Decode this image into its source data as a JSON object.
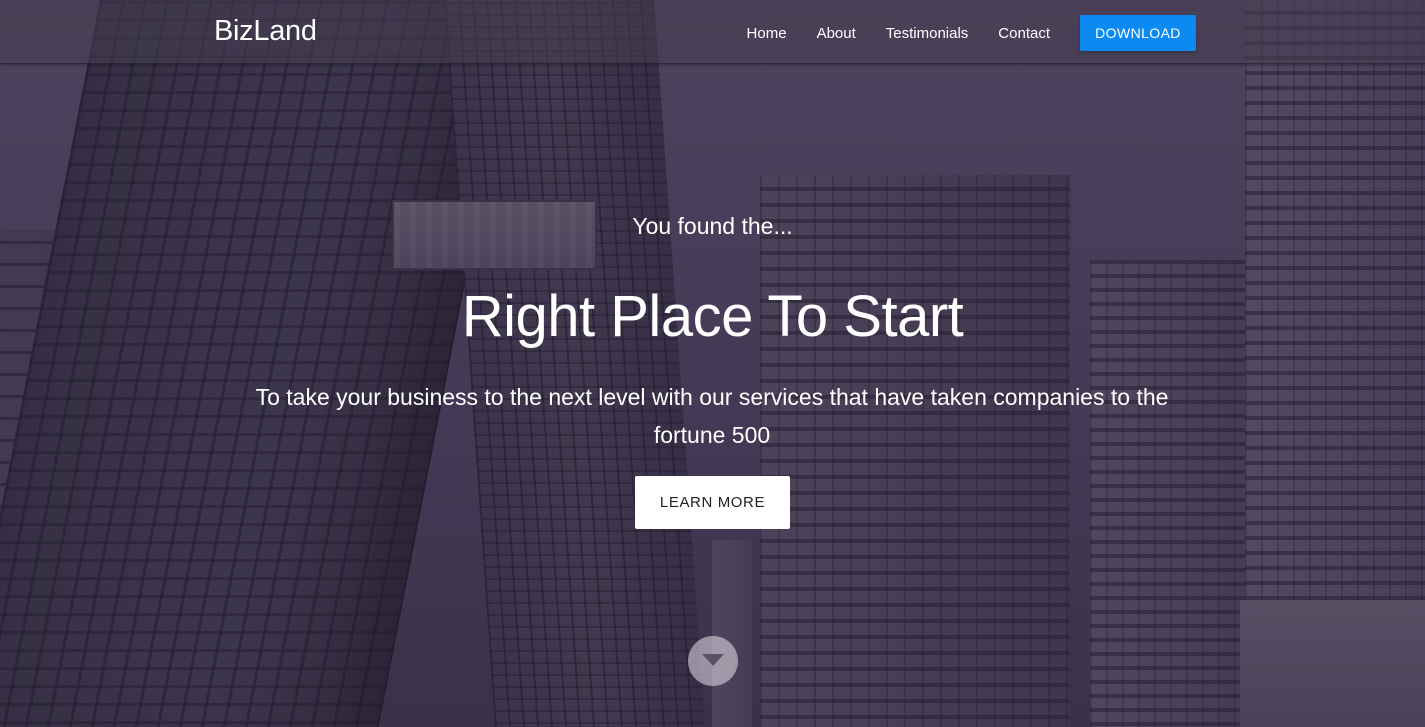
{
  "navbar": {
    "brand": "BizLand",
    "links": [
      {
        "label": "Home"
      },
      {
        "label": "About"
      },
      {
        "label": "Testimonials"
      },
      {
        "label": "Contact"
      }
    ],
    "download_label": "DOWNLOAD"
  },
  "hero": {
    "kicker": "You found the...",
    "headline": "Right Place To Start",
    "subtitle": "To take your business to the next level with our services that have taken companies to the fortune 500",
    "cta_label": "LEARN MORE",
    "scroll_icon": "chevron-down-icon"
  },
  "colors": {
    "accent": "#0b8bf2",
    "overlay": "#3c3050",
    "cta_background": "#ffffff"
  }
}
